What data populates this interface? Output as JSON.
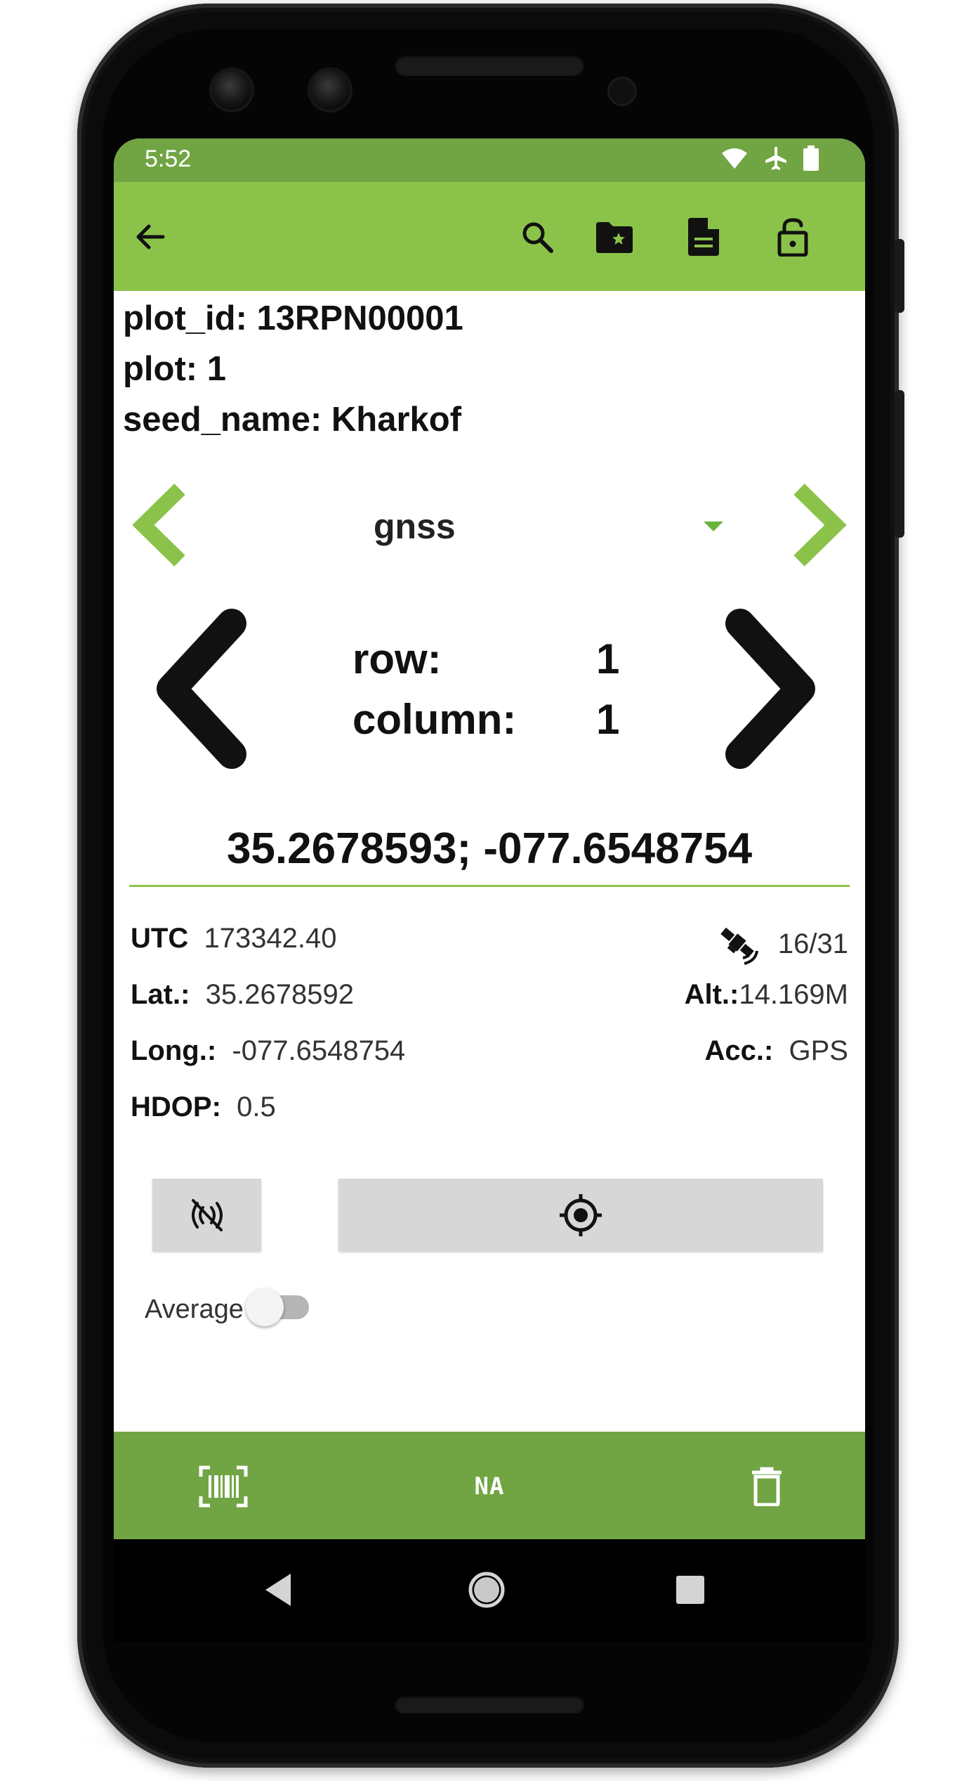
{
  "status_bar": {
    "time": "5:52",
    "icons": [
      "wifi-icon",
      "airplane-icon",
      "battery-icon"
    ]
  },
  "toolbar": {
    "icons": [
      "back-arrow-icon",
      "search-icon",
      "folder-star-icon",
      "document-icon",
      "unlock-icon"
    ]
  },
  "plot_info": {
    "plot_id": "plot_id: 13RPN00001",
    "plot": "plot: 1",
    "seed_name": "seed_name: Kharkof"
  },
  "trait_selector": {
    "selected": "gnss"
  },
  "range_nav": {
    "row_label": "row:",
    "row_value": "1",
    "column_label": "column:",
    "column_value": "1"
  },
  "gnss": {
    "value": "35.2678593; -077.6548754",
    "utc_label": "UTC",
    "utc_value": "173342.40",
    "satellites": "16/31",
    "lat_label": "Lat.:",
    "lat_value": "35.2678592",
    "alt_label": "Alt.:",
    "alt_value": "14.169M",
    "long_label": "Long.:",
    "long_value": "-077.6548754",
    "acc_label": "Acc.:",
    "acc_value": "GPS",
    "hdop_label": "HDOP:",
    "hdop_value": "0.5"
  },
  "average": {
    "label": "Average",
    "enabled": false
  },
  "bottom_bar": {
    "na_label": "NA"
  },
  "colors": {
    "status_bar": "#71a544",
    "toolbar": "#8bc34a",
    "accent": "#8bc34a"
  }
}
